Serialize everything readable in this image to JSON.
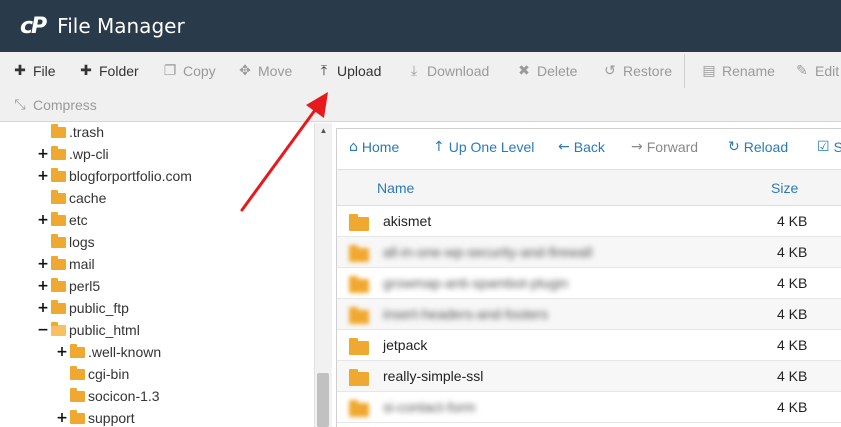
{
  "header": {
    "logo": "cP",
    "title": "File Manager"
  },
  "toolbar": {
    "file": "File",
    "folder": "Folder",
    "copy": "Copy",
    "move": "Move",
    "upload": "Upload",
    "download": "Download",
    "delete": "Delete",
    "restore": "Restore",
    "rename": "Rename",
    "edit": "Edit",
    "compress": "Compress"
  },
  "tree": {
    "items": [
      {
        "label": ".trash",
        "toggle": ""
      },
      {
        "label": ".wp-cli",
        "toggle": "+"
      },
      {
        "label": "blogforportfolio.com",
        "toggle": "+"
      },
      {
        "label": "cache",
        "toggle": ""
      },
      {
        "label": "etc",
        "toggle": "+"
      },
      {
        "label": "logs",
        "toggle": ""
      },
      {
        "label": "mail",
        "toggle": "+"
      },
      {
        "label": "perl5",
        "toggle": "+"
      },
      {
        "label": "public_ftp",
        "toggle": "+"
      },
      {
        "label": "public_html",
        "toggle": "−"
      },
      {
        "label": ".well-known",
        "toggle": "+"
      },
      {
        "label": "cgi-bin",
        "toggle": ""
      },
      {
        "label": "socicon-1.3",
        "toggle": ""
      },
      {
        "label": "support",
        "toggle": "+"
      }
    ]
  },
  "nav": {
    "home": "Home",
    "up": "Up One Level",
    "back": "Back",
    "forward": "Forward",
    "reload": "Reload",
    "select": "S"
  },
  "table": {
    "headers": {
      "name": "Name",
      "size": "Size"
    },
    "rows": [
      {
        "name": "akismet",
        "size": "4 KB"
      },
      {
        "name": "all-in-one-wp-security-and-firewall",
        "size": "4 KB"
      },
      {
        "name": "growmap-anti-spambot-plugin",
        "size": "4 KB"
      },
      {
        "name": "insert-headers-and-footers",
        "size": "4 KB"
      },
      {
        "name": "jetpack",
        "size": "4 KB"
      },
      {
        "name": "really-simple-ssl",
        "size": "4 KB"
      },
      {
        "name": "si-contact-form",
        "size": "4 KB"
      }
    ]
  },
  "colors": {
    "header_bg": "#293a4a",
    "link": "#2a7ab8",
    "folder": "#f0a930",
    "arrow": "#e8191c"
  }
}
